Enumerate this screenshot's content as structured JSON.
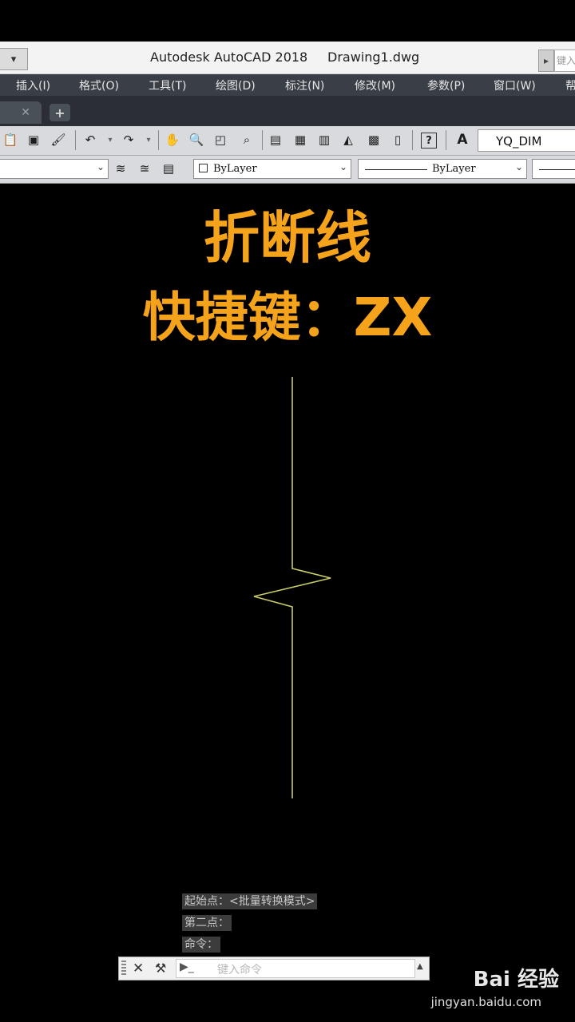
{
  "window": {
    "app_title": "Autodesk AutoCAD 2018",
    "doc_title": "Drawing1.dwg",
    "quick_access_glyph": "▾",
    "search_placeholder": "键入"
  },
  "menu": {
    "items": [
      "插入(I)",
      "格式(O)",
      "工具(T)",
      "绘图(D)",
      "标注(N)",
      "修改(M)",
      "参数(P)",
      "窗口(W)",
      "帮"
    ]
  },
  "tabs": {
    "close_glyph": "✕",
    "new_tab_glyph": "+"
  },
  "toolbar": {
    "text_style": "YQ_DIM",
    "icons": [
      "paste-icon",
      "match-icon",
      "brush-icon",
      "undo-icon",
      "redo-icon",
      "pan-icon",
      "zoom-realtime-icon",
      "zoom-window-icon",
      "zoom-previous-icon",
      "properties-icon",
      "design-center-icon",
      "tool-palette-icon",
      "sheet-set-icon",
      "markup-icon",
      "calculator-icon",
      "help-icon",
      "text-style-icon"
    ]
  },
  "properties_bar": {
    "color": "ByLayer",
    "linetype": "ByLayer"
  },
  "headline": {
    "line1": "折断线",
    "line2": "快捷键：ZX"
  },
  "drawing": {
    "stroke_color": "#c8cc6a",
    "shape": "break-line"
  },
  "command_history": [
    "起始点：<批量转换模式>",
    "第二点：",
    "命令："
  ],
  "command_input": {
    "placeholder": "键入命令",
    "close_glyph": "✕",
    "wrench_glyph": "🔧",
    "prompt_glyph": "▶_"
  },
  "watermark": {
    "brand": "Bai 经验",
    "url": "jingyan.baidu.com"
  },
  "colors": {
    "headline": "#f5a31a",
    "canvas": "#000000",
    "menubar": "#3a3f47"
  }
}
